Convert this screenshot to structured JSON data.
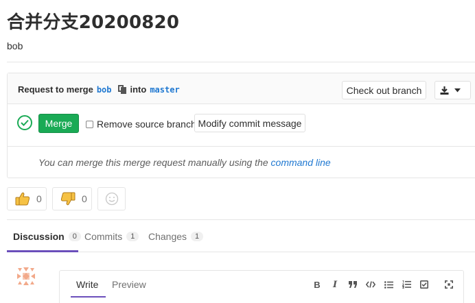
{
  "page": {
    "title": "合并分支20200820",
    "author": "bob"
  },
  "mr_widget": {
    "request_prefix": "Request to merge",
    "source_branch": "bob",
    "into_label": "into",
    "target_branch": "master",
    "checkout_label": "Check out branch",
    "merge_label": "Merge",
    "remove_source_label": "Remove source branch",
    "modify_commit_label": "Modify commit message",
    "note_text": "You can merge this merge request manually using the",
    "note_link": "command line"
  },
  "awards": {
    "thumbs_up_count": "0",
    "thumbs_down_count": "0"
  },
  "tabs": [
    {
      "label": "Discussion",
      "count": "0"
    },
    {
      "label": "Commits",
      "count": "1"
    },
    {
      "label": "Changes",
      "count": "1"
    }
  ],
  "editor": {
    "write_label": "Write",
    "preview_label": "Preview",
    "toolbar": [
      "B",
      "I"
    ]
  },
  "colors": {
    "success": "#1aaa55",
    "link": "#1f78d1",
    "accent": "#6b4fbb"
  }
}
